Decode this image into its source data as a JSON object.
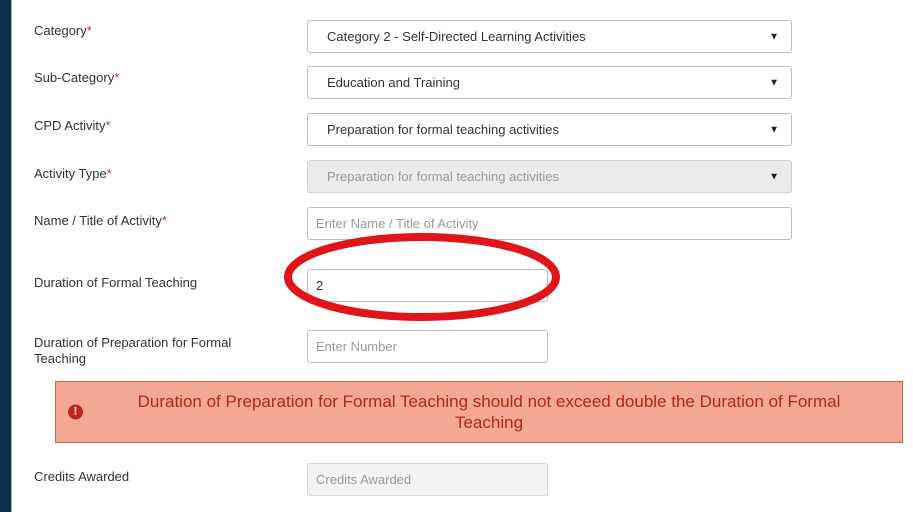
{
  "form": {
    "category": {
      "label": "Category",
      "required_mark": "*",
      "value": "Category 2 - Self-Directed Learning Activities"
    },
    "sub_category": {
      "label": "Sub-Category",
      "required_mark": "*",
      "value": "Education and Training"
    },
    "cpd_activity": {
      "label": "CPD Activity",
      "required_mark": "*",
      "value": "Preparation for formal teaching activities"
    },
    "activity_type": {
      "label": "Activity Type",
      "required_mark": "*",
      "value": "Preparation for formal teaching activities"
    },
    "activity_name": {
      "label": "Name / Title of Activity",
      "required_mark": "*",
      "placeholder": "Enter Name / Title of Activity",
      "value": ""
    },
    "duration_teaching": {
      "label": "Duration of Formal Teaching",
      "value": "2"
    },
    "duration_preparation": {
      "label": "Duration of Preparation for Formal Teaching",
      "placeholder": "Enter Number",
      "value": ""
    },
    "credits": {
      "label": "Credits Awarded",
      "placeholder": "Credits Awarded"
    }
  },
  "alert": {
    "icon": "exclamation-circle-icon",
    "message": "Duration of Preparation for Formal Teaching should not exceed double the Duration of Formal Teaching",
    "color": "#b5261c",
    "background": "#f6a896"
  },
  "annotation": {
    "color": "#e0151b"
  },
  "icons": {
    "dropdown": "caret-down-icon"
  }
}
